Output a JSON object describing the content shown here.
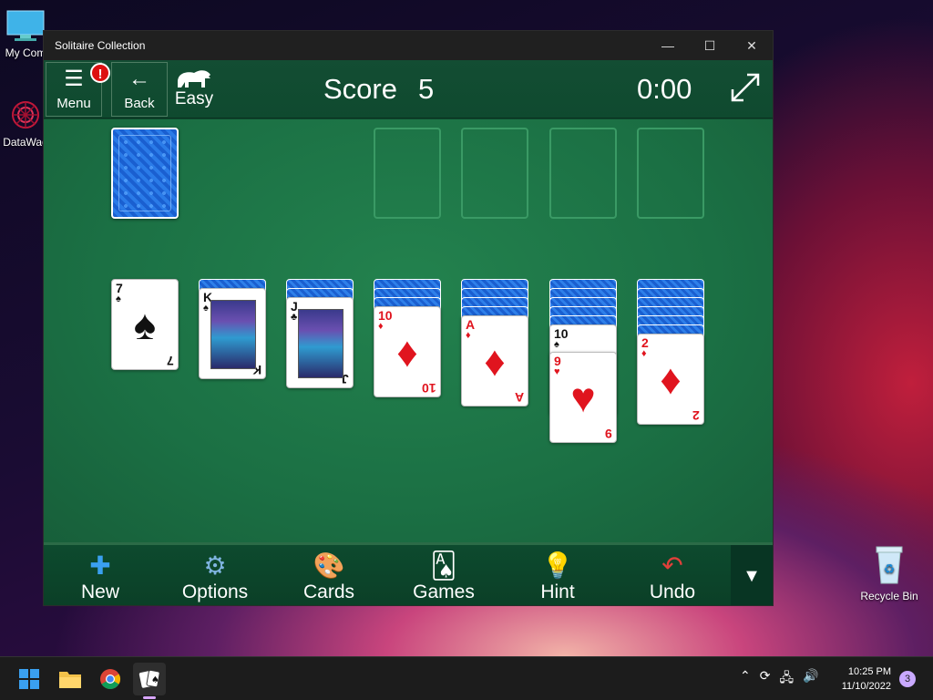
{
  "desktop": {
    "icons": [
      {
        "label": "My Com"
      },
      {
        "label": "DataWag"
      },
      {
        "label": "Recycle Bin"
      }
    ]
  },
  "window": {
    "title": "Solitaire Collection",
    "controls": {
      "minimize": "—",
      "maximize": "☐",
      "close": "✕"
    }
  },
  "gamebar": {
    "menu_label": "Menu",
    "menu_badge": "!",
    "back_label": "Back",
    "difficulty": "Easy",
    "score_label": "Score",
    "score_value": "5",
    "timer": "0:00"
  },
  "board": {
    "tableau": [
      {
        "top": {
          "rank": "7",
          "suit": "♠",
          "color": "black"
        },
        "face_down": 0
      },
      {
        "top": {
          "rank": "K",
          "suit": "♠",
          "color": "black"
        },
        "face_down": 1
      },
      {
        "top": {
          "rank": "J",
          "suit": "♣",
          "color": "black"
        },
        "face_down": 2
      },
      {
        "top": {
          "rank": "10",
          "suit": "♦",
          "color": "red"
        },
        "face_down": 3
      },
      {
        "top": {
          "rank": "A",
          "suit": "♦",
          "color": "red"
        },
        "face_down": 4
      },
      {
        "top": {
          "rank": "9",
          "suit": "♥",
          "color": "red"
        },
        "face_down": 5,
        "extra": {
          "rank": "10",
          "suit": "♠",
          "color": "black"
        }
      },
      {
        "top": {
          "rank": "2",
          "suit": "♦",
          "color": "red"
        },
        "face_down": 6
      }
    ]
  },
  "toolbar": {
    "new": "New",
    "options": "Options",
    "cards": "Cards",
    "games": "Games",
    "hint": "Hint",
    "undo": "Undo",
    "more": "▼"
  },
  "taskbar": {
    "time": "10:25 PM",
    "date": "11/10/2022",
    "notifications": "3"
  }
}
